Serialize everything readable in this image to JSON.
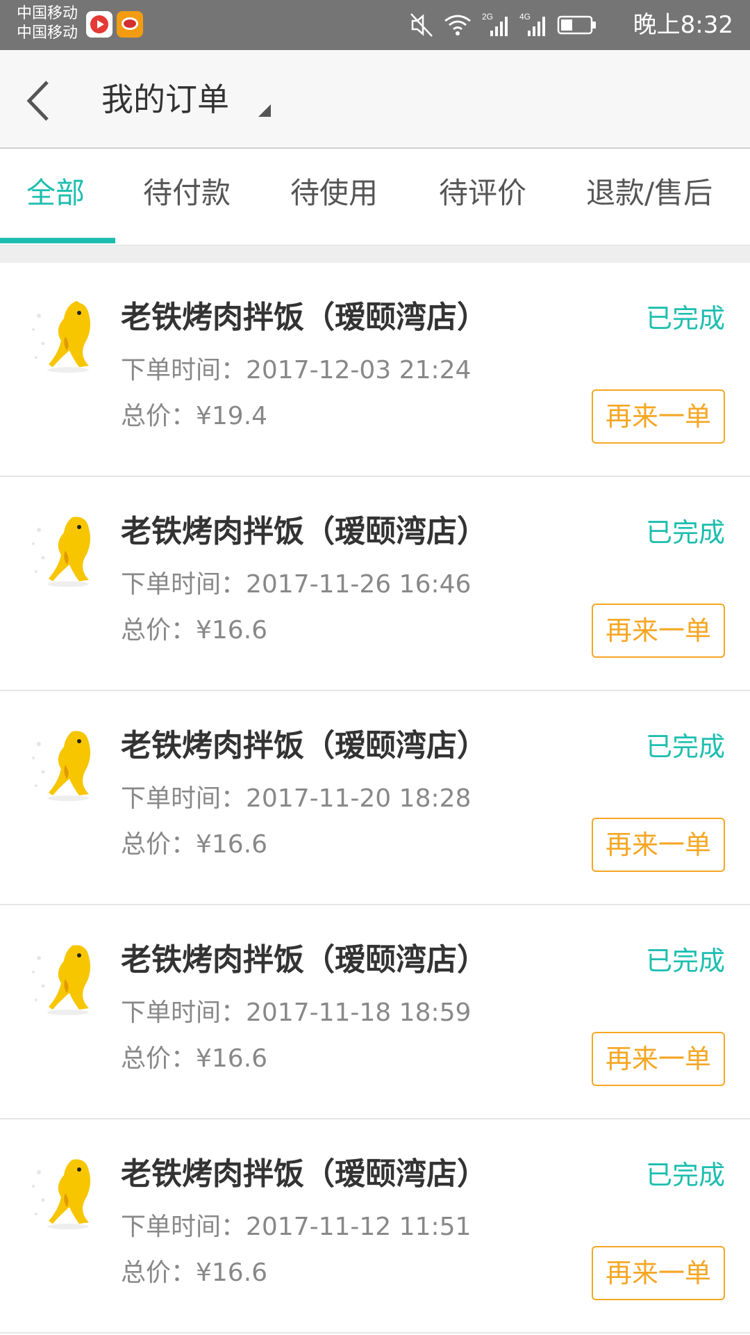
{
  "status_bar": {
    "carrier_1": "中国移动",
    "carrier_2": "中国移动",
    "time": "晚上8:32",
    "net_2g": "2G",
    "net_4g": "4G"
  },
  "header": {
    "title": "我的订单"
  },
  "tabs": [
    {
      "label": "全部",
      "active": true
    },
    {
      "label": "待付款",
      "active": false
    },
    {
      "label": "待使用",
      "active": false
    },
    {
      "label": "待评价",
      "active": false
    },
    {
      "label": "退款/售后",
      "active": false
    }
  ],
  "orders": [
    {
      "shop": "老铁烤肉拌饭（瑷颐湾店）",
      "status": "已完成",
      "time": "下单时间：2017-12-03 21:24",
      "total": "总价：¥19.4",
      "action": "再来一单"
    },
    {
      "shop": "老铁烤肉拌饭（瑷颐湾店）",
      "status": "已完成",
      "time": "下单时间：2017-11-26 16:46",
      "total": "总价：¥16.6",
      "action": "再来一单"
    },
    {
      "shop": "老铁烤肉拌饭（瑷颐湾店）",
      "status": "已完成",
      "time": "下单时间：2017-11-20 18:28",
      "total": "总价：¥16.6",
      "action": "再来一单"
    },
    {
      "shop": "老铁烤肉拌饭（瑷颐湾店）",
      "status": "已完成",
      "time": "下单时间：2017-11-18 18:59",
      "total": "总价：¥16.6",
      "action": "再来一单"
    },
    {
      "shop": "老铁烤肉拌饭（瑷颐湾店）",
      "status": "已完成",
      "time": "下单时间：2017-11-12 11:51",
      "total": "总价：¥16.6",
      "action": "再来一单"
    }
  ],
  "colors": {
    "accent": "#1dbeaf",
    "action": "#f5a623",
    "status_bar": "#757575"
  },
  "icons": {
    "back": "back-arrow-icon",
    "title_dropdown": "dropdown-caret-icon",
    "shop_logo": "kangaroo-logo-icon"
  }
}
